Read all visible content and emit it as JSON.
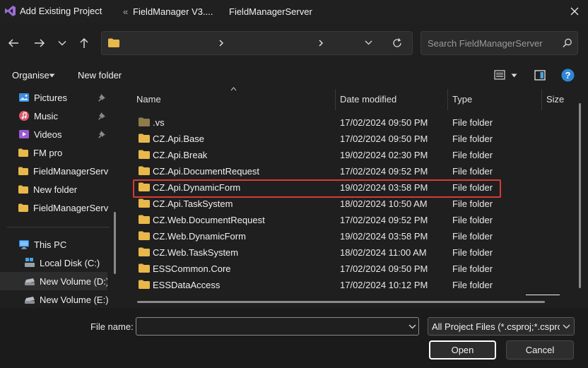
{
  "window": {
    "title": "Add Existing Project"
  },
  "address": {
    "overflow": "«",
    "crumbs": [
      "FieldManager V3....",
      "FieldManagerServer"
    ]
  },
  "search": {
    "placeholder": "Search FieldManagerServer"
  },
  "toolbar": {
    "organise": "Organise",
    "new_folder": "New folder"
  },
  "nav": {
    "items": [
      {
        "label": "Pictures",
        "icon": "pictures-icon",
        "pinned": true
      },
      {
        "label": "Music",
        "icon": "music-icon",
        "pinned": true
      },
      {
        "label": "Videos",
        "icon": "videos-icon",
        "pinned": true
      },
      {
        "label": "FM pro",
        "icon": "folder-icon",
        "pinned": false
      },
      {
        "label": "FieldManagerServ",
        "icon": "folder-icon",
        "pinned": false
      },
      {
        "label": "New folder",
        "icon": "folder-icon",
        "pinned": false
      },
      {
        "label": "FieldManagerServ",
        "icon": "folder-icon",
        "pinned": false
      }
    ],
    "this_pc": "This PC",
    "drives": [
      {
        "label": "Local Disk (C:)",
        "selected": false
      },
      {
        "label": "New Volume (D:)",
        "selected": true
      },
      {
        "label": "New Volume (E:)",
        "selected": false
      }
    ]
  },
  "columns": {
    "name": "Name",
    "date": "Date modified",
    "type": "Type",
    "size": "Size"
  },
  "files": [
    {
      "name": ".vs",
      "date": "17/02/2024 09:50 PM",
      "type": "File folder",
      "dim": true
    },
    {
      "name": "CZ.Api.Base",
      "date": "17/02/2024 09:50 PM",
      "type": "File folder",
      "dim": false
    },
    {
      "name": "CZ.Api.Break",
      "date": "19/02/2024 02:30 PM",
      "type": "File folder",
      "dim": false
    },
    {
      "name": "CZ.Api.DocumentRequest",
      "date": "17/02/2024 09:52 PM",
      "type": "File folder",
      "dim": false
    },
    {
      "name": "CZ.Api.DynamicForm",
      "date": "19/02/2024 03:58 PM",
      "type": "File folder",
      "dim": false
    },
    {
      "name": "CZ.Api.TaskSystem",
      "date": "18/02/2024 10:50 AM",
      "type": "File folder",
      "dim": false
    },
    {
      "name": "CZ.Web.DocumentRequest",
      "date": "17/02/2024 09:52 PM",
      "type": "File folder",
      "dim": false
    },
    {
      "name": "CZ.Web.DynamicForm",
      "date": "19/02/2024 03:58 PM",
      "type": "File folder",
      "dim": false
    },
    {
      "name": "CZ.Web.TaskSystem",
      "date": "18/02/2024 11:00 AM",
      "type": "File folder",
      "dim": false
    },
    {
      "name": "ESSCommon.Core",
      "date": "17/02/2024 09:50 PM",
      "type": "File folder",
      "dim": false
    },
    {
      "name": "ESSDataAccess",
      "date": "17/02/2024 10:12 PM",
      "type": "File folder",
      "dim": false
    }
  ],
  "bottom": {
    "file_name_label": "File name:",
    "file_name_value": "",
    "filter": "All Project Files (*.csproj;*.csproj",
    "open": "Open",
    "cancel": "Cancel"
  },
  "colors": {
    "folder": "#e8b84a",
    "accent": "#4aa3df",
    "highlight": "#d93a3a",
    "open_border": "#ffffff"
  }
}
